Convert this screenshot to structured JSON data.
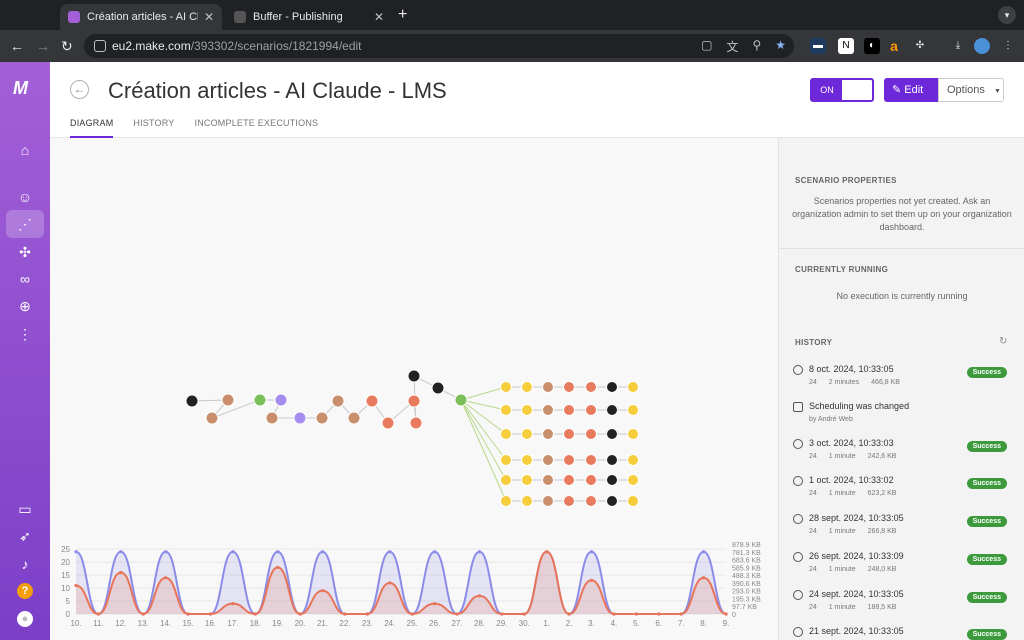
{
  "browser": {
    "tabs": [
      {
        "title": "Création articles - AI Claude - ",
        "active": true,
        "favicon_color": "#a35fd6"
      },
      {
        "title": "Buffer - Publishing",
        "active": false,
        "favicon_color": "#555"
      }
    ],
    "new_tab_glyph": "+",
    "url_host": "eu2.make.com",
    "url_path": "/393302/scenarios/1821994/edit"
  },
  "sidebar": {
    "logo": "M",
    "items": [
      {
        "icon": "home-icon",
        "glyph": "⌂"
      },
      {
        "icon": "team-icon",
        "glyph": "☺"
      },
      {
        "icon": "share-icon",
        "glyph": "⋰"
      },
      {
        "icon": "puzzle-icon",
        "glyph": "✣"
      },
      {
        "icon": "link-icon",
        "glyph": "∞"
      },
      {
        "icon": "globe-icon",
        "glyph": "⊕"
      },
      {
        "icon": "more-icon",
        "glyph": "⋮"
      },
      {
        "icon": "book-icon",
        "glyph": "▭"
      },
      {
        "icon": "rocket-icon",
        "glyph": "➶"
      },
      {
        "icon": "bell-icon",
        "glyph": "♪"
      },
      {
        "icon": "help-icon",
        "glyph": "?"
      },
      {
        "icon": "avatar-icon",
        "glyph": "●"
      }
    ]
  },
  "header": {
    "title": "Création articles - AI Claude - LMS",
    "tabs": [
      "DIAGRAM",
      "HISTORY",
      "INCOMPLETE EXECUTIONS"
    ],
    "toggle_label": "ON",
    "edit_label": "Edit",
    "options_label": "Options"
  },
  "panel": {
    "properties_heading": "SCENARIO PROPERTIES",
    "properties_text": "Scenarios properties not yet created. Ask an organization admin to set them up on your organization dashboard.",
    "running_heading": "CURRENTLY RUNNING",
    "running_text": "No execution is currently running",
    "history_heading": "HISTORY",
    "history": [
      {
        "date": "8 oct. 2024, 10:33:05",
        "ops": "24",
        "duration": "2 minutes",
        "size": "466,8 KB",
        "status": "Success"
      },
      {
        "date": "Scheduling was changed",
        "by": "by André Web",
        "type": "schedule"
      },
      {
        "date": "3 oct. 2024, 10:33:03",
        "ops": "24",
        "duration": "1 minute",
        "size": "242,6 KB",
        "status": "Success"
      },
      {
        "date": "1 oct. 2024, 10:33:02",
        "ops": "24",
        "duration": "1 minute",
        "size": "623,2 KB",
        "status": "Success"
      },
      {
        "date": "28 sept. 2024, 10:33:05",
        "ops": "24",
        "duration": "1 minute",
        "size": "266,8 KB",
        "status": "Success"
      },
      {
        "date": "26 sept. 2024, 10:33:09",
        "ops": "24",
        "duration": "1 minute",
        "size": "248,0 KB",
        "status": "Success"
      },
      {
        "date": "24 sept. 2024, 10:33:05",
        "ops": "24",
        "duration": "1 minute",
        "size": "188,5 KB",
        "status": "Success"
      },
      {
        "date": "21 sept. 2024, 10:33:05",
        "ops": "",
        "duration": "",
        "size": "",
        "status": "Success"
      }
    ]
  },
  "colors": {
    "accent": "#6d28d9",
    "success": "#3c9a3c",
    "series_ops": "#8b8be8",
    "series_data": "#e8745a"
  },
  "chart_data": {
    "type": "area",
    "x": [
      "10.",
      "11.",
      "12.",
      "13.",
      "14.",
      "15.",
      "16.",
      "17.",
      "18.",
      "19.",
      "20.",
      "21.",
      "22.",
      "23.",
      "24.",
      "25.",
      "26.",
      "27.",
      "28.",
      "29.",
      "30.",
      "1.",
      "2.",
      "3.",
      "4.",
      "5.",
      "6.",
      "7.",
      "8.",
      "9."
    ],
    "y_left_ticks": [
      "0",
      "5",
      "10",
      "15",
      "20",
      "25"
    ],
    "y_right_ticks": [
      "0",
      "97.7 KB",
      "195.3 KB",
      "293.0 KB",
      "390.6 KB",
      "488.3 KB",
      "585.9 KB",
      "683.6 KB",
      "781.3 KB",
      "878.9 KB"
    ],
    "ylim": [
      0,
      27
    ],
    "series": [
      {
        "values": [
          24,
          0,
          24,
          0,
          24,
          0,
          0,
          24,
          0,
          24,
          0,
          24,
          0,
          0,
          24,
          0,
          24,
          0,
          24,
          0,
          0,
          24,
          0,
          24,
          0,
          0,
          0,
          0,
          24,
          0
        ]
      },
      {
        "values": [
          11,
          0,
          16,
          0,
          14,
          0,
          0,
          4,
          0,
          18,
          0,
          9,
          0,
          0,
          12,
          0,
          4,
          0,
          7,
          0,
          0,
          24,
          0,
          13,
          0,
          0,
          0,
          0,
          14,
          0
        ]
      }
    ]
  }
}
